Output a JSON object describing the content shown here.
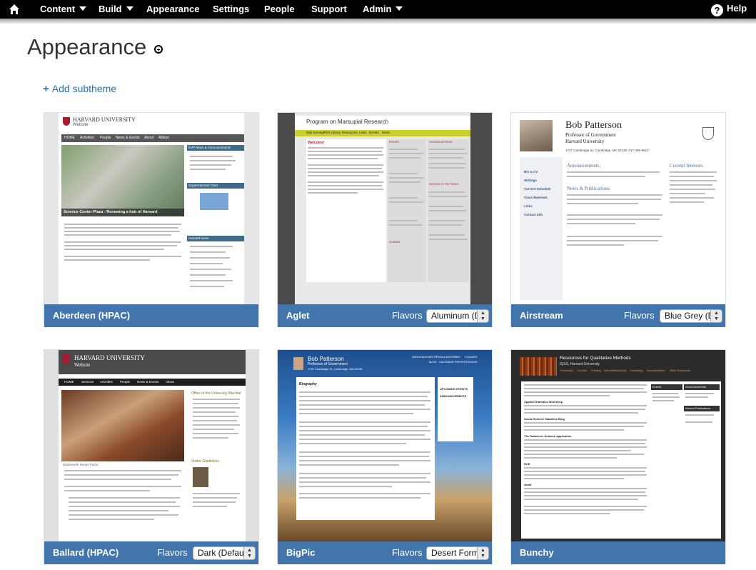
{
  "nav": {
    "items": [
      {
        "label": "Content",
        "caret": true
      },
      {
        "label": "Build",
        "caret": true
      },
      {
        "label": "Appearance",
        "caret": false
      },
      {
        "label": "Settings",
        "caret": false
      },
      {
        "label": "People",
        "caret": false
      },
      {
        "label": "Support",
        "caret": false
      },
      {
        "label": "Admin",
        "caret": true
      }
    ],
    "help": "Help"
  },
  "page": {
    "title": "Appearance",
    "add_subtheme": "Add subtheme"
  },
  "themes": [
    {
      "name": "Aberdeen (HPAC)",
      "flavors_label": "",
      "flavor": "",
      "thumb": {
        "org": "HARVARD UNIVERSITY",
        "sub": "Website",
        "menu": [
          "HOME",
          "Activities",
          "People",
          "News & Events",
          "About",
          "Allston"
        ],
        "caption": "Science Center Plaza - Renewing a hub of Harvard",
        "right_heads": [
          "EVP News & Announcements",
          "Organizational Chart",
          "Harvard News"
        ]
      }
    },
    {
      "name": "Aglet",
      "flavors_label": "Flavors",
      "flavor": "Aluminum (D",
      "thumb": {
        "title": "Program on Marsupial Research",
        "menu": [
          "Mail Surveys",
          "PSR Library",
          "Resources",
          "Links",
          "Events",
          "News"
        ],
        "h_welcome": "Welcome!",
        "h_events": "Events",
        "h_ann": "Announcements",
        "h_surveys": "Surveys in the News",
        "h_contact": "Contact"
      }
    },
    {
      "name": "Airstream",
      "flavors_label": "Flavors",
      "flavor": "Blue Grey (D",
      "thumb": {
        "person": "Bob Patterson",
        "role": "Professor of Government",
        "org": "Harvard University",
        "addr": "1737 Cambridge St, Cambridge, MA 02138, 617-495-9614",
        "links": [
          "Bio & CV",
          "Writings",
          "Current Schedule",
          "Class Materials",
          "Links",
          "Contact Info"
        ],
        "announcements": "Announcements:",
        "news": "News & Publications:",
        "interests": "Current Interests"
      }
    },
    {
      "name": "Ballard (HPAC)",
      "flavors_label": "Flavors",
      "flavor": "Dark (Defau",
      "thumb": {
        "org": "HARVARD UNIVERSITY",
        "sub": "Website",
        "menu": [
          "HOME",
          "Services",
          "Activities",
          "People",
          "News & Events",
          "About"
        ],
        "side1": "Office of the University Marshal",
        "side2": "Visitor Guidelines",
        "caption": "Wadsworth House Parlor"
      }
    },
    {
      "name": "BigPic",
      "flavors_label": "Flavors",
      "flavor": "Desert Form",
      "thumb": {
        "person": "Bob Patterson",
        "role": "Professor of Government",
        "addr": "1737 Cambridge St, Cambridge, MA 02138",
        "menu": [
          "ANNOUNCEMENTS",
          "PUBLICATIONS",
          "BIO",
          "CLASSES",
          "BLOG",
          "CALENDAR",
          "PRESENTATIONS"
        ],
        "h_bio": "Biography",
        "side": [
          "UPCOMING EVENTS",
          "ANNOUNCEMENTS"
        ]
      }
    },
    {
      "name": "Bunchy",
      "flavors_label": "",
      "flavor": "",
      "thumb": {
        "title": "Resources for Qualitative Methods",
        "sub": "IQSS, Harvard University",
        "menu": [
          "Community",
          "Courses",
          "Funding",
          "Events/Workshops",
          "Computing",
          "Documentation",
          "Other Resources"
        ],
        "side": [
          "Events",
          "Announcements",
          "Recent Publications"
        ],
        "item1": "Applied Statistics Workshop",
        "item2": "Social Science Statistics Blog",
        "item3": "The Dataverse Network application",
        "item4": "RCE",
        "item5": "zlodd"
      }
    }
  ],
  "colors": {
    "bar": "#4375ad",
    "link": "#2570b6",
    "topbar": "#000000"
  }
}
